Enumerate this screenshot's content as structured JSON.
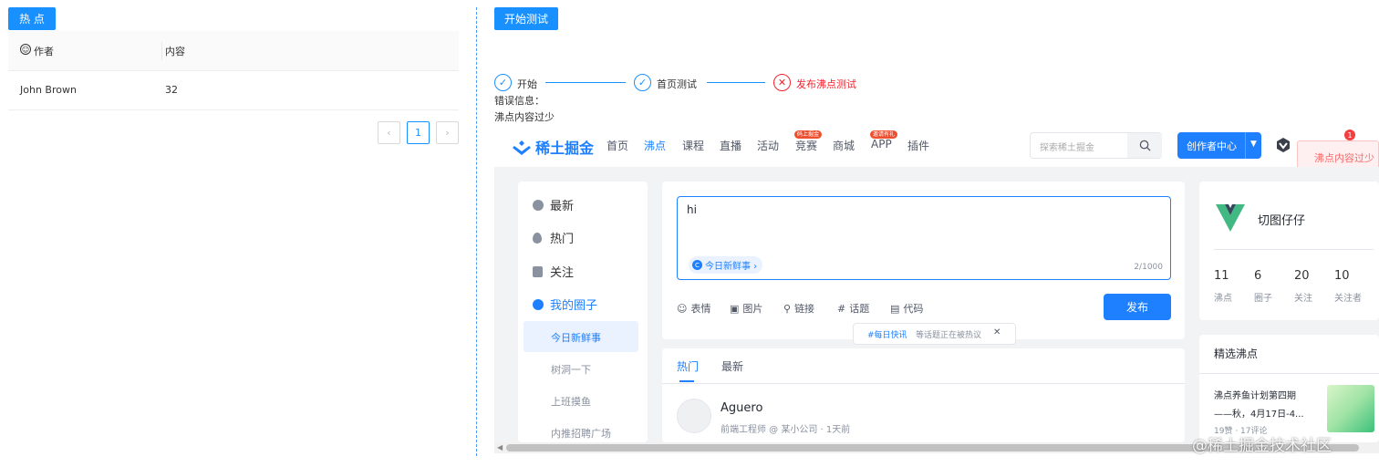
{
  "left": {
    "hot_button": "热 点",
    "table": {
      "col_author": "作者",
      "col_content": "内容",
      "rows": [
        {
          "author": "John Brown",
          "content": "32"
        }
      ]
    },
    "pagination": {
      "prev": "‹",
      "page": "1",
      "next": "›"
    }
  },
  "right": {
    "start_button": "开始测试",
    "steps": [
      {
        "label": "开始",
        "status": "done"
      },
      {
        "label": "首页测试",
        "status": "done"
      },
      {
        "label": "发布沸点测试",
        "status": "error"
      }
    ],
    "error_title": "错误信息：",
    "error_message": "沸点内容过少",
    "toast": "沸点内容过少"
  },
  "juejin": {
    "logo_text": "稀土掘金",
    "nav": [
      "首页",
      "沸点",
      "课程",
      "直播",
      "活动",
      "竞赛",
      "商城",
      "APP",
      "插件"
    ],
    "nav_active": "沸点",
    "badges": {
      "竞赛": "码上掘金",
      "APP": "邀请有礼"
    },
    "search_placeholder": "探索稀土掘金",
    "creator_button": "创作者中心",
    "notification_count": "1",
    "sidebar": [
      {
        "label": "最新",
        "icon": "clock-icon"
      },
      {
        "label": "热门",
        "icon": "flame-icon"
      },
      {
        "label": "关注",
        "icon": "follow-icon"
      },
      {
        "label": "我的圈子",
        "icon": "circle-icon"
      }
    ],
    "sidebar_sub": [
      "今日新鲜事",
      "树洞一下",
      "上班摸鱼",
      "内推招聘广场"
    ],
    "editor": {
      "text": "hi",
      "topic_tag": "今日新鲜事 ›",
      "counter": "2/1000",
      "tools": [
        "表情",
        "图片",
        "链接",
        "话题",
        "代码"
      ],
      "publish": "发布"
    },
    "news_bar": {
      "tag": "#每日快讯",
      "text": "等话题正在被热议",
      "close": "✕"
    },
    "feed_tabs": [
      "热门",
      "最新"
    ],
    "post": {
      "author": "Aguero",
      "meta": "前端工程师 @ 某小公司 · 1天前"
    },
    "profile": {
      "name": "切图仔仔",
      "stats": [
        {
          "num": "11",
          "label": "沸点"
        },
        {
          "num": "6",
          "label": "圈子"
        },
        {
          "num": "20",
          "label": "关注"
        },
        {
          "num": "10",
          "label": "关注者"
        }
      ]
    },
    "featured": {
      "title": "精选沸点",
      "item_line1": "沸点养鱼计划第四期",
      "item_line2": "——秋，4月17日-4...",
      "item_meta": "19赞 · 17评论"
    },
    "watermark": "@稀土掘金技术社区"
  },
  "colors": {
    "accent": "#1890ff",
    "juejin_blue": "#1e80ff",
    "error": "#f5222d"
  }
}
